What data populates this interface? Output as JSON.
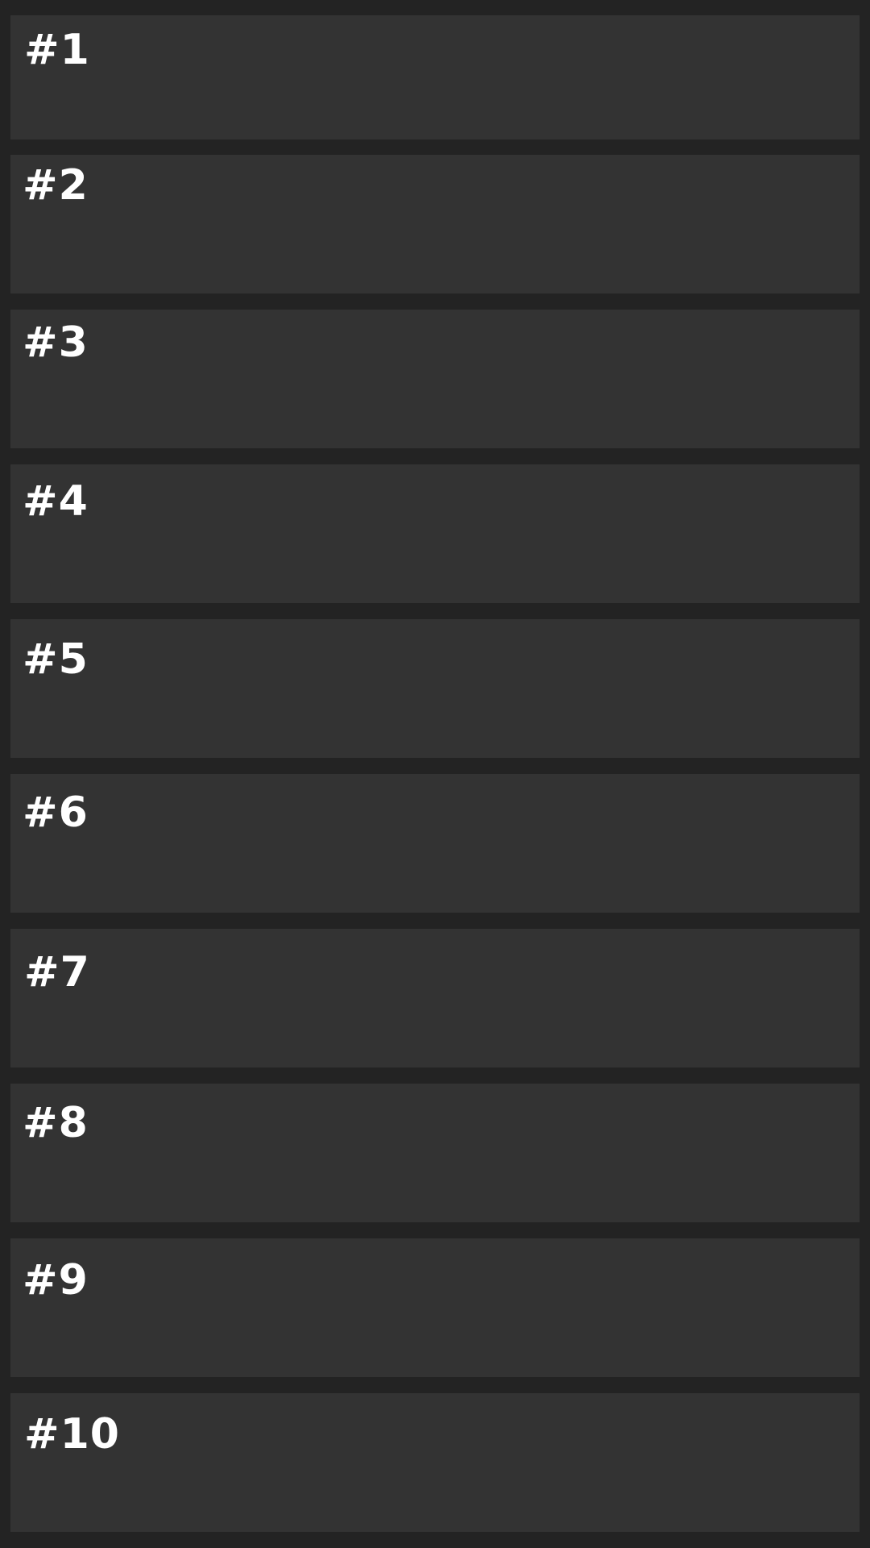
{
  "items": [
    {
      "label": "#1"
    },
    {
      "label": "#2"
    },
    {
      "label": "#3"
    },
    {
      "label": "#4"
    },
    {
      "label": "#5"
    },
    {
      "label": "#6"
    },
    {
      "label": "#7"
    },
    {
      "label": "#8"
    },
    {
      "label": "#9"
    },
    {
      "label": "#10"
    }
  ],
  "colors": {
    "background": "#232323",
    "card": "#333333",
    "text": "#ffffff"
  }
}
